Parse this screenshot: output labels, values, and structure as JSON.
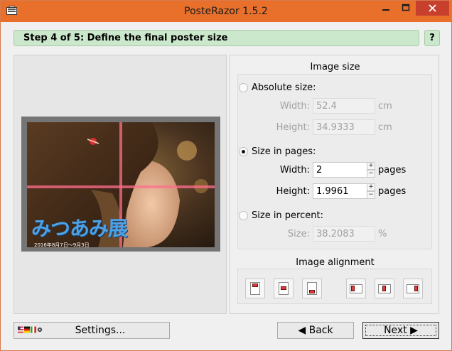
{
  "window": {
    "title": "PosteRazor 1.5.2",
    "icon": "poster-razor-app-icon",
    "controls": {
      "minimize": "minimize-icon",
      "maximize": "maximize-icon",
      "close": "close-icon"
    }
  },
  "step": {
    "label": "Step 4 of 5: Define the final poster size",
    "help": "?"
  },
  "preview": {
    "caption": "みつあみ展",
    "date": "2016年8月7日～9月3日",
    "columns": 2,
    "rows": 2
  },
  "image_size": {
    "title": "Image size",
    "absolute": {
      "label": "Absolute size:",
      "selected": false,
      "width_label": "Width:",
      "width_value": "52.4",
      "width_unit": "cm",
      "height_label": "Height:",
      "height_value": "34.9333",
      "height_unit": "cm"
    },
    "pages": {
      "label": "Size in pages:",
      "selected": true,
      "width_label": "Width:",
      "width_value": "2",
      "width_unit": "pages",
      "height_label": "Height:",
      "height_value": "1.9961",
      "height_unit": "pages"
    },
    "percent": {
      "label": "Size in percent:",
      "selected": false,
      "size_label": "Size:",
      "size_value": "38.2083",
      "size_unit": "%"
    }
  },
  "alignment": {
    "title": "Image alignment",
    "buttons": [
      "align-top-icon",
      "align-vcenter-icon",
      "align-bottom-icon",
      "align-left-icon",
      "align-hcenter-icon",
      "align-right-icon"
    ]
  },
  "buttons": {
    "settings": "Settings...",
    "back": "Back",
    "next": "Next"
  },
  "colors": {
    "titlebar": "#e8702b",
    "close": "#c7402e",
    "step_bar": "#cce8cc",
    "cut_line": "#ff6e8c",
    "caption": "#4aa3e8"
  }
}
